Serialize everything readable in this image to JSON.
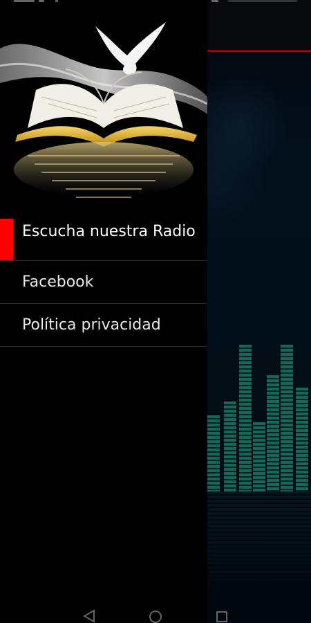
{
  "drawer": {
    "menu_items": [
      {
        "label": "Escucha nuestra Radio",
        "active": true
      },
      {
        "label": "Facebook",
        "active": false
      },
      {
        "label": "Política privacidad",
        "active": false
      }
    ]
  },
  "colors": {
    "active_marker": "#ff0000",
    "topbar_accent": "#c4161c",
    "equalizer": "#2ab59a"
  },
  "icons": {
    "header_image": "bible-dove-icon",
    "nav_back": "back-triangle-icon",
    "nav_home": "home-circle-icon",
    "nav_recents": "recents-square-icon"
  }
}
